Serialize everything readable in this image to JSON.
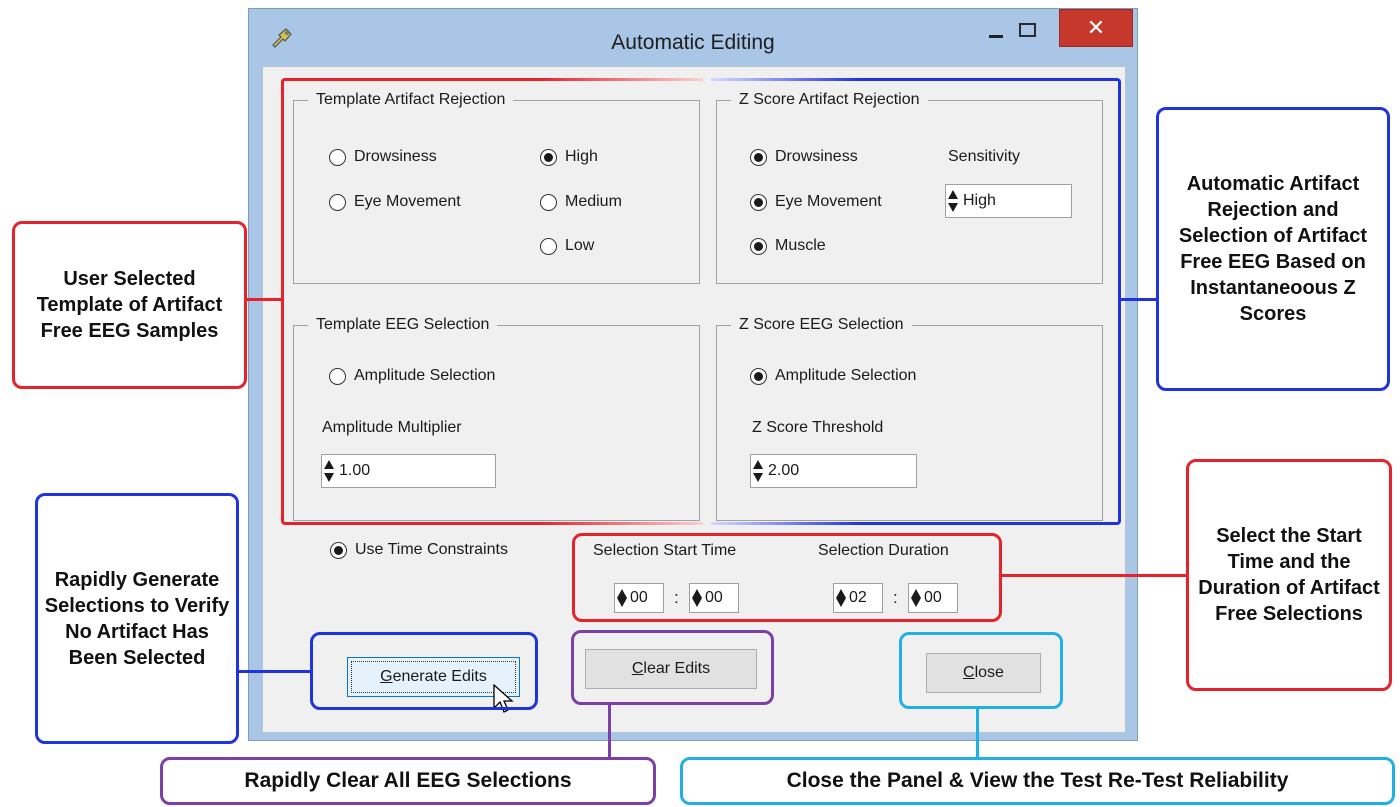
{
  "window": {
    "title": "Automatic Editing",
    "close_glyph": "✕",
    "icons": [
      "app-icon",
      "minimize-icon",
      "maximize-icon",
      "close-icon"
    ]
  },
  "template_artifact": {
    "title": "Template Artifact Rejection",
    "drowsiness": "Drowsiness",
    "eye_movement": "Eye Movement",
    "high": "High",
    "medium": "Medium",
    "low": "Low"
  },
  "zscore_artifact": {
    "title": "Z Score Artifact Rejection",
    "drowsiness": "Drowsiness",
    "eye_movement": "Eye Movement",
    "muscle": "Muscle",
    "sensitivity_label": "Sensitivity",
    "sensitivity_value": "High"
  },
  "template_eeg": {
    "title": "Template EEG Selection",
    "amplitude_selection": "Amplitude Selection",
    "multiplier_label": "Amplitude Multiplier",
    "multiplier_value": "1.00"
  },
  "zscore_eeg": {
    "title": "Z Score EEG Selection",
    "amplitude_selection": "Amplitude Selection",
    "threshold_label": "Z Score Threshold",
    "threshold_value": "2.00"
  },
  "time": {
    "use_time_constraints": "Use Time Constraints",
    "start_label": "Selection Start Time",
    "start_min": "00",
    "start_sec": "00",
    "duration_label": "Selection Duration",
    "duration_min": "02",
    "duration_sec": "00",
    "separator": ":"
  },
  "buttons": {
    "generate_prefix": "G",
    "generate_rest": "enerate Edits",
    "clear_prefix": "C",
    "clear_rest": "lear Edits",
    "close_prefix": "C",
    "close_rest": "lose"
  },
  "callouts": {
    "user_template": "User Selected Template of Artifact Free EEG Samples",
    "automatic": "Automatic Artifact Rejection and Selection of Artifact Free EEG Based on Instantaneoous Z Scores",
    "rapid_generate": "Rapidly Generate Selections to Verify No Artifact Has Been Selected",
    "start_time": "Select the Start Time and the Duration of Artifact Free Selections",
    "clear_all": "Rapidly Clear All EEG Selections",
    "close_panel": "Close the Panel & View the Test Re-Test Reliability"
  },
  "colors": {
    "red": "#e8222a",
    "blue": "#1f33e0",
    "purple": "#7b3fa5",
    "cyan": "#1fb1e6",
    "window_frame": "#a9c6e6",
    "close_button": "#c7382c"
  }
}
